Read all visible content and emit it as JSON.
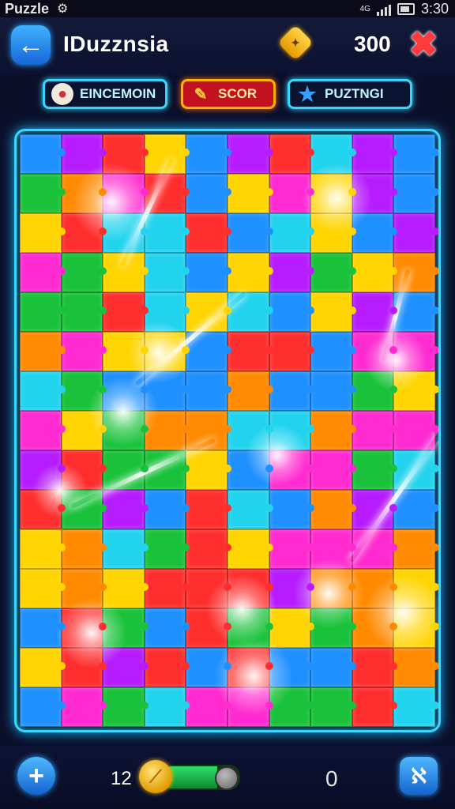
{
  "status_bar": {
    "app_name": "Puzzle",
    "time": "3:30",
    "gear_icon": "gear-icon",
    "network_label": "4G"
  },
  "header": {
    "title": "IDuzznsia",
    "score": "300",
    "back_icon": "arrow-left-icon",
    "close_icon": "close-icon",
    "coin_icon": "star-coin-icon"
  },
  "chips": [
    {
      "label": "EINCEMOIN",
      "icon": "ball-icon",
      "accent": "#37d6ff"
    },
    {
      "label": "SCOR",
      "icon": "pencil-icon",
      "accent": "#ffb000"
    },
    {
      "label": "PUZTNGI",
      "icon": "star-icon",
      "accent": "#37d6ff"
    }
  ],
  "board": {
    "columns": 10,
    "rows": 15,
    "palette": [
      "#ff2e2e",
      "#ffd400",
      "#19c23a",
      "#1e90ff",
      "#b61cff",
      "#ff2ad0",
      "#ff8a00",
      "#22d3ee"
    ]
  },
  "bottom_bar": {
    "level": "12",
    "progress": 0.72,
    "count": "0",
    "add_icon": "plus-icon",
    "hint_icon": "hint-icon"
  },
  "colors": {
    "frame_glow": "#38d8ff",
    "background": "#0b0f2a"
  }
}
